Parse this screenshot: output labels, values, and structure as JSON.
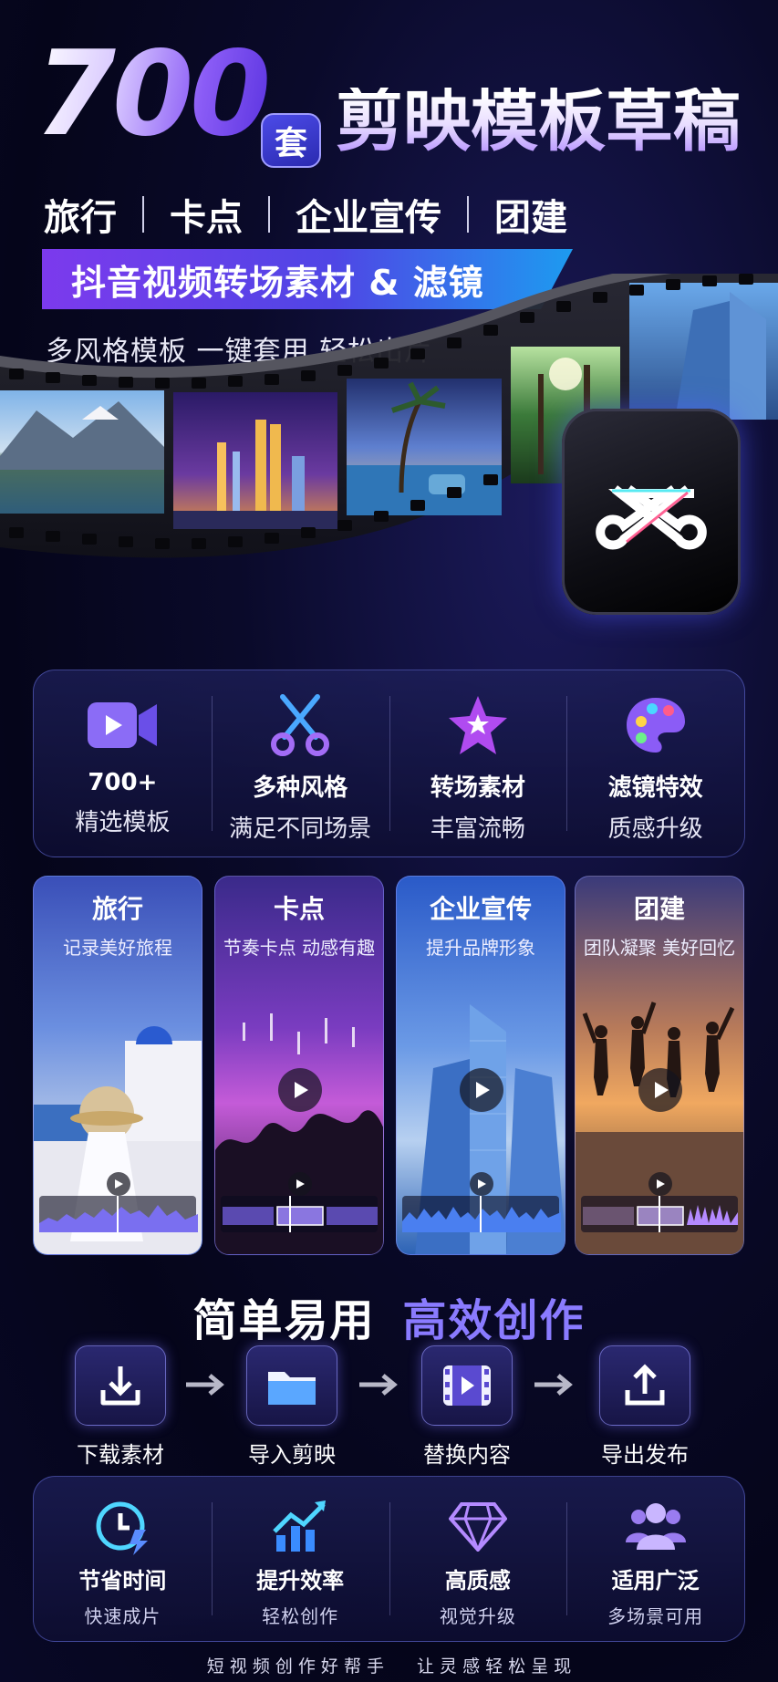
{
  "hero": {
    "number": "700",
    "badge": "套",
    "title": "剪映模板草稿",
    "categories": [
      "旅行",
      "卡点",
      "企业宣传",
      "团建"
    ],
    "ribbon": "抖音视频转场素材 & 滤镜",
    "tagline": "多风格模板 一键套用 轻松出片"
  },
  "logo": {
    "icon": "capcut-logo-icon"
  },
  "features": [
    {
      "icon": "video-camera-icon",
      "title": "700+",
      "desc": "精选模板"
    },
    {
      "icon": "scissors-icon",
      "title": "多种风格",
      "desc": "满足不同场景"
    },
    {
      "icon": "star-icon",
      "title": "转场素材",
      "desc": "丰富流畅"
    },
    {
      "icon": "palette-icon",
      "title": "滤镜特效",
      "desc": "质感升级"
    }
  ],
  "cards": [
    {
      "title": "旅行",
      "subtitle": "记录美好旅程"
    },
    {
      "title": "卡点",
      "subtitle": "节奏卡点 动感有趣"
    },
    {
      "title": "企业宣传",
      "subtitle": "提升品牌形象"
    },
    {
      "title": "团建",
      "subtitle": "团队凝聚 美好回忆"
    }
  ],
  "steps_section": {
    "title_a": "简单易用",
    "title_b": "高效创作",
    "steps": [
      {
        "icon": "download-icon",
        "label": "下载素材"
      },
      {
        "icon": "folder-icon",
        "label": "导入剪映"
      },
      {
        "icon": "film-icon",
        "label": "替换内容"
      },
      {
        "icon": "upload-icon",
        "label": "导出发布"
      }
    ]
  },
  "benefits": [
    {
      "icon": "clock-bolt-icon",
      "title": "节省时间",
      "desc": "快速成片"
    },
    {
      "icon": "chart-up-icon",
      "title": "提升效率",
      "desc": "轻松创作"
    },
    {
      "icon": "diamond-icon",
      "title": "高质感",
      "desc": "视觉升级"
    },
    {
      "icon": "users-icon",
      "title": "适用广泛",
      "desc": "多场景可用"
    }
  ],
  "footer": {
    "left": "短 视 频 创 作 好 帮 手",
    "right": "让 灵 感 轻 松 呈 现"
  },
  "colors": {
    "accent": "#8b5cf6",
    "ribbon_start": "#7c3aed",
    "ribbon_end": "#1d9bf0",
    "bg": "#0a0a2a"
  }
}
